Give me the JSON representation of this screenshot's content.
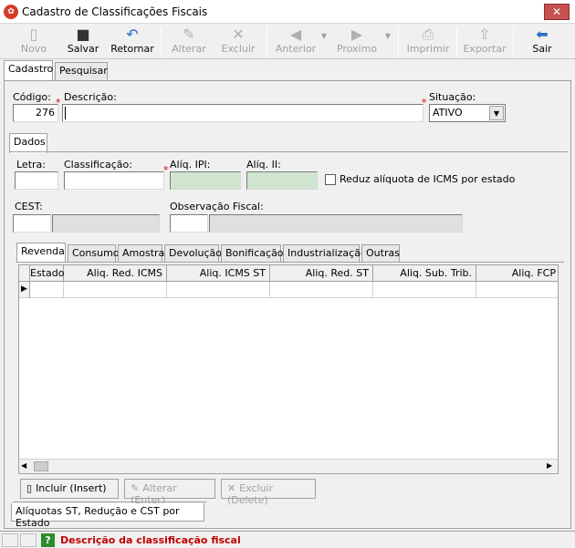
{
  "window": {
    "title": "Cadastro de Classificações Fiscais",
    "close": "✕"
  },
  "toolbar": {
    "novo": "Novo",
    "salvar": "Salvar",
    "retornar": "Retornar",
    "alterar": "Alterar",
    "excluir": "Excluir",
    "anterior": "Anterior",
    "proximo": "Proximo",
    "imprimir": "Imprimir",
    "exportar": "Exportar",
    "sair": "Sair"
  },
  "main_tabs": {
    "cadastro": "Cadastro",
    "pesquisar": "Pesquisar"
  },
  "form": {
    "codigo_label": "Código:",
    "codigo_value": "276",
    "descricao_label": "Descrição:",
    "descricao_value": "",
    "situacao_label": "Situação:",
    "situacao_value": "ATIVO"
  },
  "dados_tab": "Dados",
  "dados": {
    "letra_label": "Letra:",
    "classificacao_label": "Classificação:",
    "aliq_ipi_label": "Alíq. IPI:",
    "aliq_ii_label": "Alíq. II:",
    "reduz_label": "Reduz alíquota de ICMS por estado",
    "cest_label": "CEST:",
    "obs_label": "Observação Fiscal:"
  },
  "sub_tabs": [
    "Revenda",
    "Consumo",
    "Amostra",
    "Devolução",
    "Bonificação",
    "Industrialização",
    "Outras"
  ],
  "grid": {
    "columns": [
      "Estado",
      "Aliq. Red. ICMS",
      "Aliq. ICMS ST",
      "Aliq. Red. ST",
      "Aliq. Sub. Trib.",
      "Aliq. FCP"
    ]
  },
  "grid_buttons": {
    "incluir": "Incluir (Insert)",
    "alterar": "Alterar (Enter)",
    "excluir": "Excluir (Delete)"
  },
  "bottom_tab": "Alíquotas ST, Redução e CST por Estado",
  "status": {
    "message": "Descrição da classificação fiscal",
    "help": "?"
  },
  "colors": {
    "required": "#d00000",
    "status_text": "#c00000",
    "green_field": "#cfe5cf"
  }
}
